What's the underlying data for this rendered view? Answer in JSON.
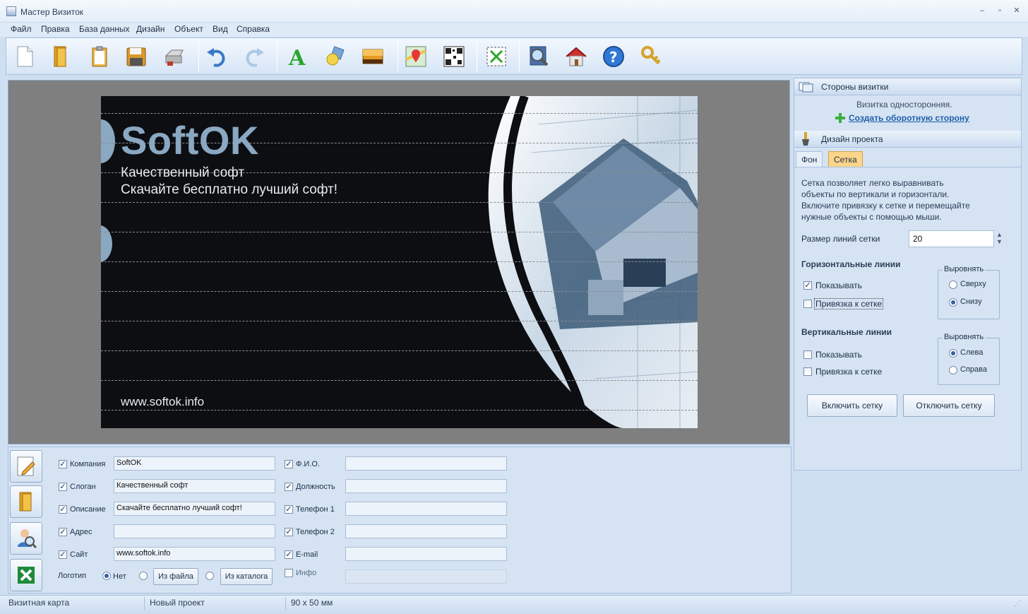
{
  "window": {
    "title": "Мастер Визиток"
  },
  "menu": [
    "Файл",
    "Правка",
    "База данных",
    "Дизайн",
    "Объект",
    "Вид",
    "Справка"
  ],
  "toolbar": {
    "icons": [
      "new-document-icon",
      "open-folder-icon",
      "clipboard-icon",
      "save-disk-icon",
      "printer-icon",
      "undo-icon",
      "redo-icon",
      "text-icon",
      "shapes-icon",
      "image-icon",
      "map-icon",
      "qr-code-icon",
      "fit-expand-icon",
      "zoom-search-icon",
      "home-icon",
      "help-icon",
      "keys-icon"
    ]
  },
  "card": {
    "company": "SoftOK",
    "slogan": "Качественный софт",
    "description": "Скачайте бесплатно лучший софт!",
    "site": "www.softok.info"
  },
  "sides": {
    "title": "Стороны визитки",
    "status": "Визитка односторонняя.",
    "create_link": "Создать оборотную сторону"
  },
  "design": {
    "title": "Дизайн проекта",
    "tabs": [
      "Фон",
      "Сетка"
    ],
    "active_tab": "Сетка",
    "info": [
      "Сетка позволяет легко выравнивать",
      "объекты по вертикали и горизонтали.",
      "Включите привязку к сетке и перемещайте",
      "нужные объекты с помощью мыши."
    ],
    "grid_size_label": "Размер линий сетки",
    "grid_size_value": "20",
    "horizontal": {
      "title": "Горизонтальные линии",
      "show": "Показывать",
      "show_checked": true,
      "snap": "Привязка к сетке",
      "snap_checked": false,
      "align_title": "Выровнять",
      "align_options": [
        "Сверху",
        "Снизу"
      ],
      "align_selected": "Снизу"
    },
    "vertical": {
      "title": "Вертикальные линии",
      "show": "Показывать",
      "show_checked": false,
      "snap": "Привязка к сетке",
      "snap_checked": false,
      "align_title": "Выровнять",
      "align_options": [
        "Слева",
        "Справа"
      ],
      "align_selected": "Слева"
    },
    "enable_btn": "Включить сетку",
    "disable_btn": "Отключить сетку"
  },
  "fields": {
    "left": [
      {
        "label": "Компания",
        "value": "SoftOK",
        "checked": true
      },
      {
        "label": "Слоган",
        "value": "Качественный софт",
        "checked": true
      },
      {
        "label": "Описание",
        "value": "Скачайте бесплатно лучший софт!",
        "checked": true
      },
      {
        "label": "Адрес",
        "value": "",
        "checked": true
      },
      {
        "label": "Сайт",
        "value": "www.softok.info",
        "checked": true
      }
    ],
    "right": [
      {
        "label": "Ф.И.О.",
        "value": "",
        "checked": true
      },
      {
        "label": "Должность",
        "value": "",
        "checked": true
      },
      {
        "label": "Телефон 1",
        "value": "",
        "checked": true
      },
      {
        "label": "Телефон 2",
        "value": "",
        "checked": true
      },
      {
        "label": "E-mail",
        "value": "",
        "checked": true
      },
      {
        "label": "Инфо",
        "value": "",
        "checked": false
      }
    ],
    "logo": {
      "label": "Логотип",
      "options": [
        "Нет",
        "Из файла",
        "Из каталога"
      ],
      "selected": "Нет"
    }
  },
  "status": [
    "Визитная карта",
    "Новый проект",
    "90 x 50 мм"
  ],
  "colors": {
    "accent": "#2d5fa8",
    "card_bg": "#0d0e12",
    "company_text": "#8aa8c2",
    "canvas_bg": "#7f7f7f",
    "active_tab": "#fbd58a"
  }
}
